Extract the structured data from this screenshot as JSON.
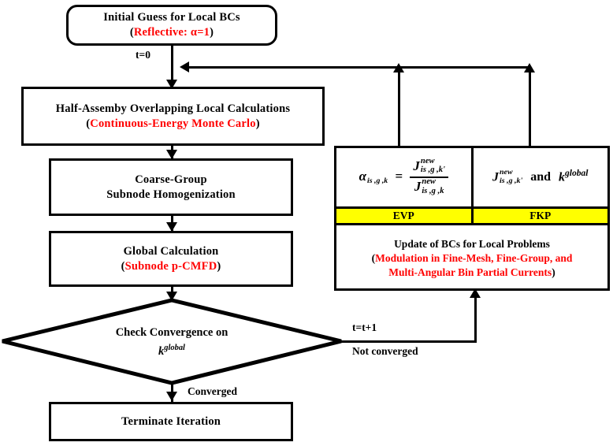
{
  "diagram": {
    "title": "Iterative local-global coupling scheme flowchart",
    "colors": {
      "accent_red": "#ff0000",
      "highlight_yellow": "#ffff00",
      "stroke": "#000000",
      "background": "#ffffff"
    }
  },
  "nodes": {
    "initial_guess": {
      "line1": "Initial Guess for Local BCs",
      "line2_open": "(",
      "line2_red": "Reflective: α=1",
      "line2_close": ")",
      "shape": "rounded-rectangle"
    },
    "local_calc": {
      "line1": "Half-Assemby Overlapping  Local Calculations",
      "line2_open": "(",
      "line2_red": "Continuous-Energy  Monte Carlo",
      "line2_close": ")",
      "shape": "rectangle"
    },
    "homogenization": {
      "line1": "Coarse-Group",
      "line2": "Subnode Homogenization",
      "shape": "rectangle"
    },
    "global_calc": {
      "line1": "Global Calculation",
      "line2_open": "(",
      "line2_red": "Subnode p-CMFD",
      "line2_close": ")",
      "shape": "rectangle"
    },
    "decision": {
      "line1": "Check Convergence on",
      "line2_base": "k",
      "line2_sup": "global",
      "shape": "diamond"
    },
    "terminate": {
      "line1": "Terminate Iteration",
      "shape": "rectangle"
    }
  },
  "right_panel": {
    "evp_formula": {
      "alpha_base": "α",
      "alpha_sub": "is ,g ,k",
      "equals": "=",
      "numerator": {
        "base": "J",
        "sup": "new",
        "sub": "is ,g ,k'"
      },
      "denominator": {
        "base": "J",
        "sup": "new",
        "sub": "is ,g ,k"
      }
    },
    "fkp_formula": {
      "term1": {
        "base": "J",
        "sup": "new",
        "sub": "is ,g ,k'"
      },
      "conjunction": "and",
      "term2_base": "k",
      "term2_sup": "global"
    },
    "tags": {
      "left": "EVP",
      "right": "FKP"
    },
    "update_box": {
      "line1": "Update  of BCs for  Local Problems",
      "line2_open": "(",
      "line2_red": "Modulation  in  Fine-Mesh, Fine-Group,  and",
      "line3_red": "Multi-Angular  Bin Partial  Currents",
      "line3_close": ")"
    }
  },
  "edge_labels": {
    "t_zero": "t=0",
    "t_increment": "t=t+1",
    "not_converged": "Not converged",
    "converged": "Converged"
  }
}
